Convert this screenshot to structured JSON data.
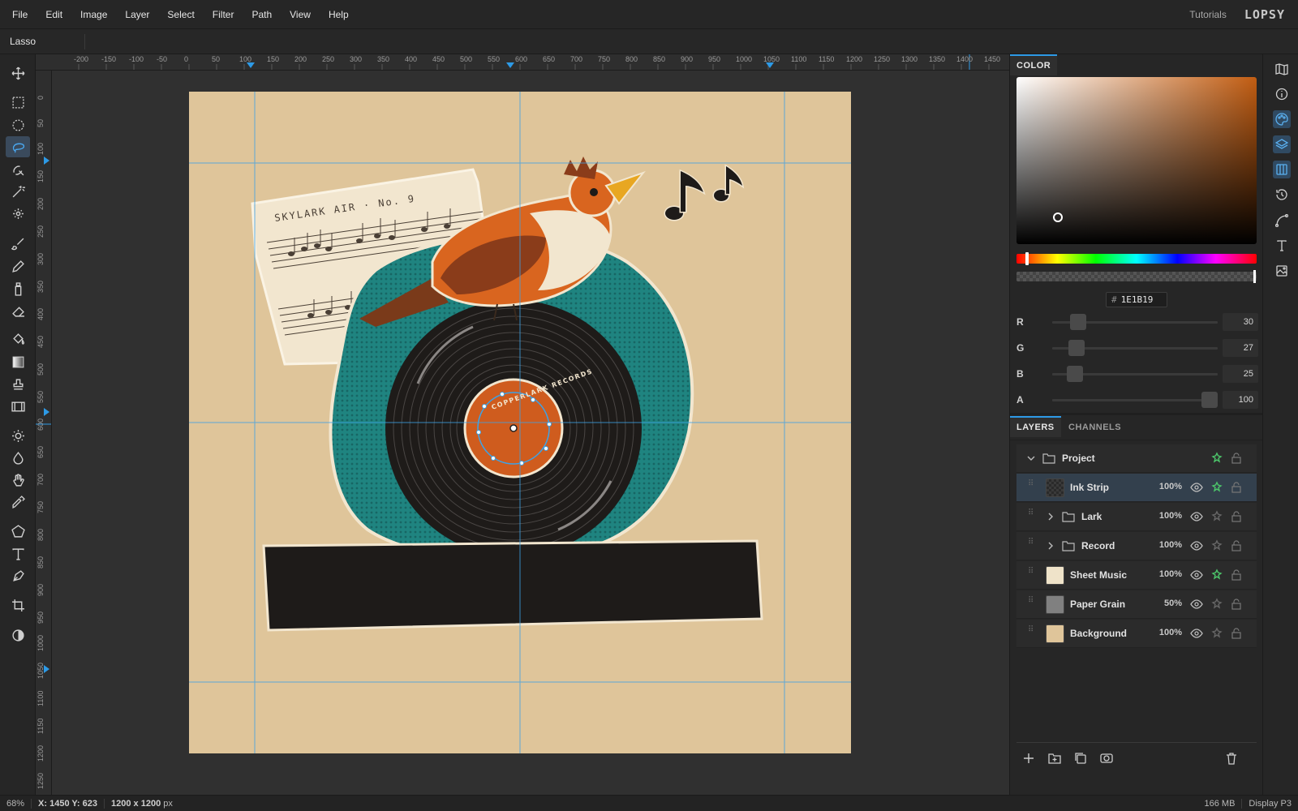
{
  "app": {
    "logo": "LOPSY",
    "tutorials": "Tutorials"
  },
  "menu": [
    "File",
    "Edit",
    "Image",
    "Layer",
    "Select",
    "Filter",
    "Path",
    "View",
    "Help"
  ],
  "options_bar": {
    "tool_name": "Lasso"
  },
  "toolbar": {
    "tools": [
      "move-tool",
      "rect-marquee-tool",
      "ellipse-marquee-tool",
      "lasso-tool",
      "quick-select-tool",
      "magic-wand-tool",
      "spot-heal-tool",
      "brush-tool",
      "pencil-tool",
      "clone-stamp-tool",
      "eraser-tool",
      "paint-bucket-tool",
      "gradient-tool",
      "stamp-tool",
      "film-tool",
      "dodge-tool",
      "burn-tool",
      "hand-tool",
      "eyedropper-tool",
      "polygon-tool",
      "text-tool",
      "pen-tool",
      "crop-tool",
      "contrast-tool"
    ],
    "active": "lasso-tool"
  },
  "rulers": {
    "horizontal": [
      "-200",
      "-150",
      "-100",
      "-50",
      "0",
      "50",
      "100",
      "150",
      "200",
      "250",
      "300",
      "350",
      "400",
      "450",
      "500",
      "550",
      "600",
      "650",
      "700",
      "750",
      "800",
      "850",
      "900",
      "950",
      "1000",
      "1050",
      "1100",
      "1150",
      "1200",
      "1250",
      "1300",
      "1350",
      "1400",
      "1450"
    ],
    "vertical": [
      "0",
      "50",
      "100",
      "150",
      "200",
      "250",
      "300",
      "350",
      "400",
      "450",
      "500",
      "550",
      "600",
      "650",
      "700",
      "750",
      "800",
      "850",
      "900",
      "950",
      "1000",
      "1050",
      "1100",
      "1150",
      "1200",
      "1250"
    ]
  },
  "artwork": {
    "sheet_music_title": "SKYLARK AIR · No. 9",
    "record_label_text": "COPPERLARK RECORDS"
  },
  "color_panel": {
    "tab": "COLOR",
    "hex": "1E1B19",
    "hex_prefix": "#",
    "channels": [
      {
        "label": "R",
        "value": "30",
        "fraction": 0.118
      },
      {
        "label": "G",
        "value": "27",
        "fraction": 0.106
      },
      {
        "label": "B",
        "value": "25",
        "fraction": 0.098
      },
      {
        "label": "A",
        "value": "100",
        "fraction": 1.0
      }
    ]
  },
  "layers_panel": {
    "tabs": [
      "LAYERS",
      "CHANNELS"
    ],
    "active_tab": "LAYERS",
    "group": {
      "name": "Project"
    },
    "layers": [
      {
        "name": "Ink Strip",
        "opacity": "100%",
        "type": "layer",
        "thumb": "checker",
        "selected": true,
        "fx": true
      },
      {
        "name": "Lark",
        "opacity": "100%",
        "type": "group",
        "fx": false
      },
      {
        "name": "Record",
        "opacity": "100%",
        "type": "group",
        "fx": false
      },
      {
        "name": "Sheet Music",
        "opacity": "100%",
        "type": "layer",
        "thumb": "sheet",
        "fx": true
      },
      {
        "name": "Paper Grain",
        "opacity": "50%",
        "type": "layer",
        "thumb": "grey",
        "fx": false
      },
      {
        "name": "Background",
        "opacity": "100%",
        "type": "layer",
        "thumb": "tan",
        "fx": false
      }
    ]
  },
  "status": {
    "zoom": "68%",
    "coords": "X: 1450 Y: 623",
    "doc_size_value": "1200 x 1200",
    "doc_size_unit": "px",
    "memory": "166 MB",
    "color_profile": "Display P3"
  },
  "colors": {
    "accent": "#2d9ae6",
    "canvas_bg": "#dfc59a",
    "teal": "#1f8480",
    "vinyl": "#1e1b19",
    "label_orange": "#cf5c1e"
  }
}
